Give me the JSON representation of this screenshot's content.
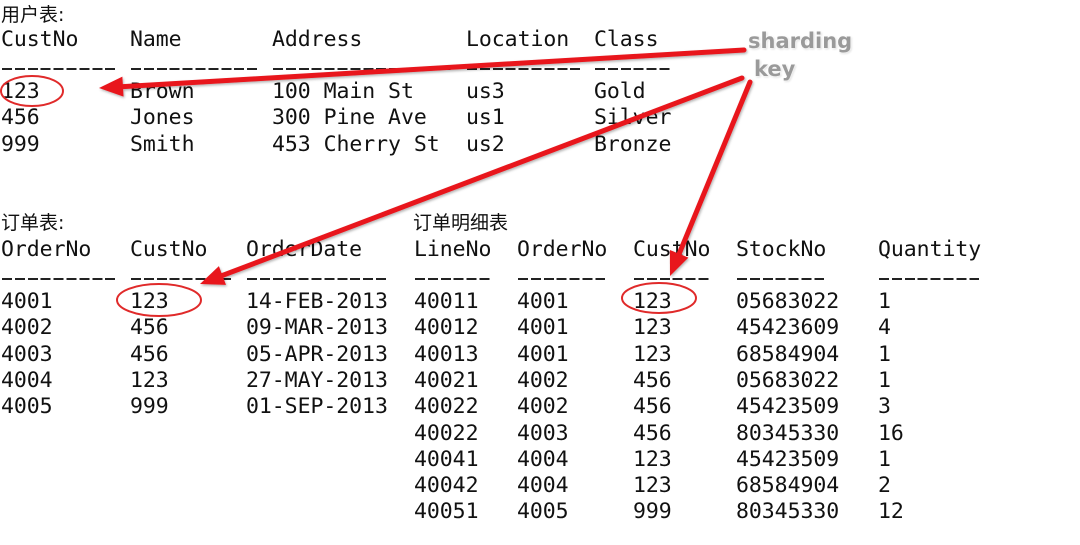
{
  "customers_table": {
    "title": "用户表:",
    "columns": [
      "CustNo",
      "Name",
      "Address",
      "Location",
      "Class"
    ],
    "dash_counts": [
      9,
      10,
      14,
      9,
      6
    ],
    "rows": [
      [
        "123",
        "Brown",
        "100 Main St",
        "us3",
        "Gold"
      ],
      [
        "456",
        "Jones",
        "300 Pine Ave",
        "us1",
        "Silver"
      ],
      [
        "999",
        "Smith",
        "453 Cherry St",
        "us2",
        "Bronze"
      ]
    ]
  },
  "orders_table": {
    "title": "订单表:",
    "columns": [
      "OrderNo",
      "CustNo",
      "OrderDate"
    ],
    "dash_counts": [
      9,
      8,
      11
    ],
    "rows": [
      [
        "4001",
        "123",
        "14-FEB-2013"
      ],
      [
        "4002",
        "456",
        "09-MAR-2013"
      ],
      [
        "4003",
        "456",
        "05-APR-2013"
      ],
      [
        "4004",
        "123",
        "27-MAY-2013"
      ],
      [
        "4005",
        "999",
        "01-SEP-2013"
      ]
    ]
  },
  "line_items_table": {
    "title": "订单明细表",
    "columns": [
      "LineNo",
      "OrderNo",
      "CustNo",
      "StockNo",
      "Quantity"
    ],
    "dash_counts": [
      6,
      7,
      6,
      7,
      8
    ],
    "rows": [
      [
        "40011",
        "4001",
        "123",
        "05683022",
        "1"
      ],
      [
        "40012",
        "4001",
        "123",
        "45423609",
        "4"
      ],
      [
        "40013",
        "4001",
        "123",
        "68584904",
        "1"
      ],
      [
        "40021",
        "4002",
        "456",
        "05683022",
        "1"
      ],
      [
        "40022",
        "4002",
        "456",
        "45423509",
        "3"
      ],
      [
        "40022",
        "4003",
        "456",
        "80345330",
        "16"
      ],
      [
        "40041",
        "4004",
        "123",
        "45423509",
        "1"
      ],
      [
        "40042",
        "4004",
        "123",
        "68584904",
        "2"
      ],
      [
        "40051",
        "4005",
        "999",
        "80345330",
        "12"
      ]
    ]
  },
  "annotation": {
    "label_line1": "sharding",
    "label_line2": "key",
    "arrow_color": "#e8141c",
    "label_color": "#9a9a9a",
    "highlighted_value": "123"
  }
}
